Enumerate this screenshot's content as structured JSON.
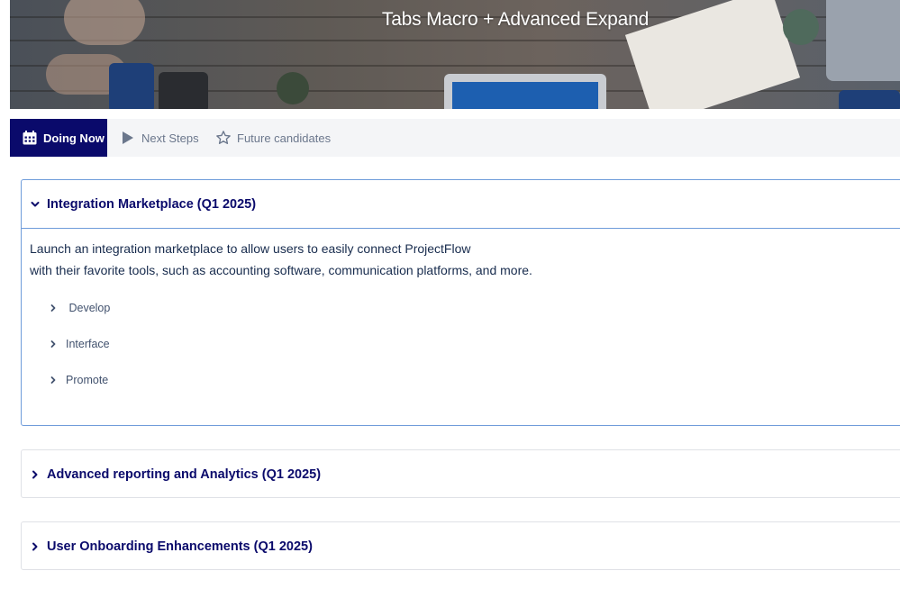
{
  "banner": {
    "title": "Tabs Macro + Advanced Expand"
  },
  "tabs": [
    {
      "label": "Doing Now",
      "icon": "calendar-icon",
      "active": true
    },
    {
      "label": "Next Steps",
      "icon": "play-icon",
      "active": false
    },
    {
      "label": "Future candidates",
      "icon": "star-icon",
      "active": false
    }
  ],
  "sections": [
    {
      "title": "Integration Marketplace (Q1 2025)",
      "expanded": true,
      "description": [
        "Launch an integration marketplace to allow users to easily connect ProjectFlow",
        "with their favorite tools, such as accounting software, communication platforms, and more."
      ],
      "children": [
        " Develop",
        "Interface",
        "Promote"
      ]
    },
    {
      "title": "Advanced reporting and Analytics (Q1 2025)",
      "expanded": false
    },
    {
      "title": "User Onboarding Enhancements (Q1 2025)",
      "expanded": false
    }
  ],
  "colors": {
    "active_tab": "#0a0a6b",
    "heading": "#0a0a6b",
    "focus_border": "#6f9cda"
  }
}
